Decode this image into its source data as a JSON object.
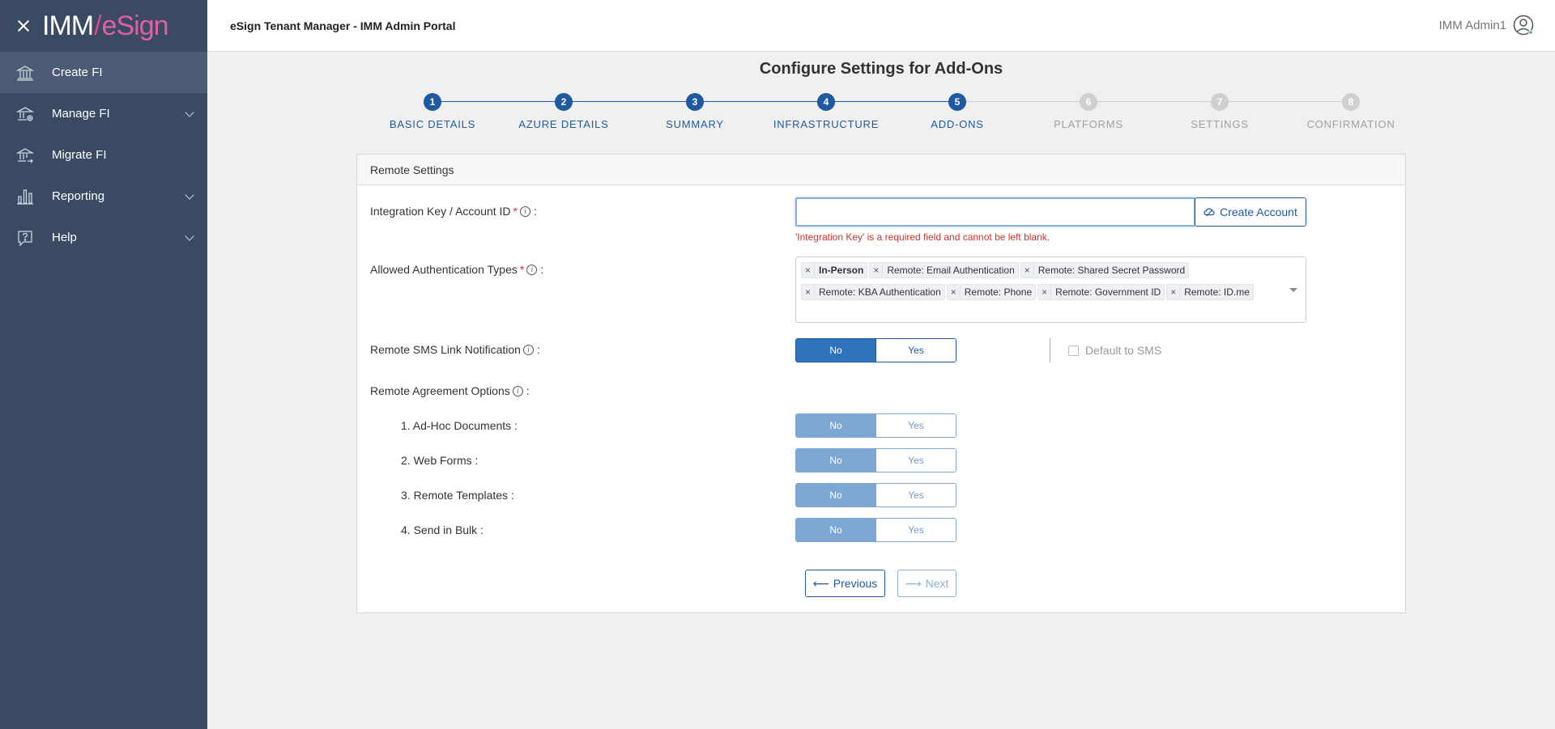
{
  "sidebar": {
    "logo": {
      "part1": "IMM",
      "slash": "/",
      "part2": "eSign"
    },
    "items": [
      {
        "label": "Create FI",
        "icon": "bank-icon",
        "expandable": false
      },
      {
        "label": "Manage FI",
        "icon": "bank-gear-icon",
        "expandable": true
      },
      {
        "label": "Migrate FI",
        "icon": "bank-arrow-icon",
        "expandable": false
      },
      {
        "label": "Reporting",
        "icon": "bar-chart-icon",
        "expandable": true
      },
      {
        "label": "Help",
        "icon": "help-icon",
        "expandable": true
      }
    ]
  },
  "header": {
    "title": "eSign Tenant Manager - IMM Admin Portal",
    "user_name": "IMM Admin1"
  },
  "page": {
    "title": "Configure Settings for Add-Ons"
  },
  "stepper": {
    "steps": [
      {
        "number": "1",
        "label": "BASIC DETAILS",
        "state": "done"
      },
      {
        "number": "2",
        "label": "AZURE DETAILS",
        "state": "done"
      },
      {
        "number": "3",
        "label": "SUMMARY",
        "state": "done"
      },
      {
        "number": "4",
        "label": "INFRASTRUCTURE",
        "state": "done"
      },
      {
        "number": "5",
        "label": "ADD-ONS",
        "state": "current"
      },
      {
        "number": "6",
        "label": "PLATFORMS",
        "state": "pending"
      },
      {
        "number": "7",
        "label": "SETTINGS",
        "state": "pending"
      },
      {
        "number": "8",
        "label": "CONFIRMATION",
        "state": "pending"
      }
    ]
  },
  "form": {
    "section_title": "Remote Settings",
    "integration_key": {
      "label": "Integration Key / Account ID",
      "required": "*",
      "info": "i",
      "colon": ":",
      "value": "",
      "error": "'Integration Key' is a required field and cannot be left blank.",
      "create_button": "Create Account"
    },
    "auth_types": {
      "label": "Allowed Authentication Types",
      "required": "*",
      "info": "i",
      "colon": ":",
      "remove_glyph": "×",
      "tags": [
        "In-Person",
        "Remote: Email Authentication",
        "Remote: Shared Secret Password",
        "Remote: KBA Authentication",
        "Remote: Phone",
        "Remote: Government ID",
        "Remote: ID.me"
      ]
    },
    "sms": {
      "label": "Remote SMS Link Notification",
      "info": "i",
      "colon": ":",
      "no": "No",
      "yes": "Yes",
      "selected": "No",
      "default_sms_label": "Default to SMS",
      "default_sms_checked": false
    },
    "agreement": {
      "label": "Remote Agreement Options",
      "info": "i",
      "colon": ":",
      "options": [
        {
          "label": "1. Ad-Hoc Documents :",
          "no": "No",
          "yes": "Yes",
          "selected": "No"
        },
        {
          "label": "2. Web Forms :",
          "no": "No",
          "yes": "Yes",
          "selected": "No"
        },
        {
          "label": "3. Remote Templates :",
          "no": "No",
          "yes": "Yes",
          "selected": "No"
        },
        {
          "label": "4. Send in Bulk :",
          "no": "No",
          "yes": "Yes",
          "selected": "No"
        }
      ]
    },
    "nav": {
      "previous": "Previous",
      "next": "Next",
      "prev_arrow": "⟵",
      "next_arrow": "⟶"
    }
  },
  "colors": {
    "sidebar_bg": "#3b4a63",
    "primary": "#1f5aa0",
    "error": "#d32f2f",
    "brand_pink": "#e35fa4"
  }
}
